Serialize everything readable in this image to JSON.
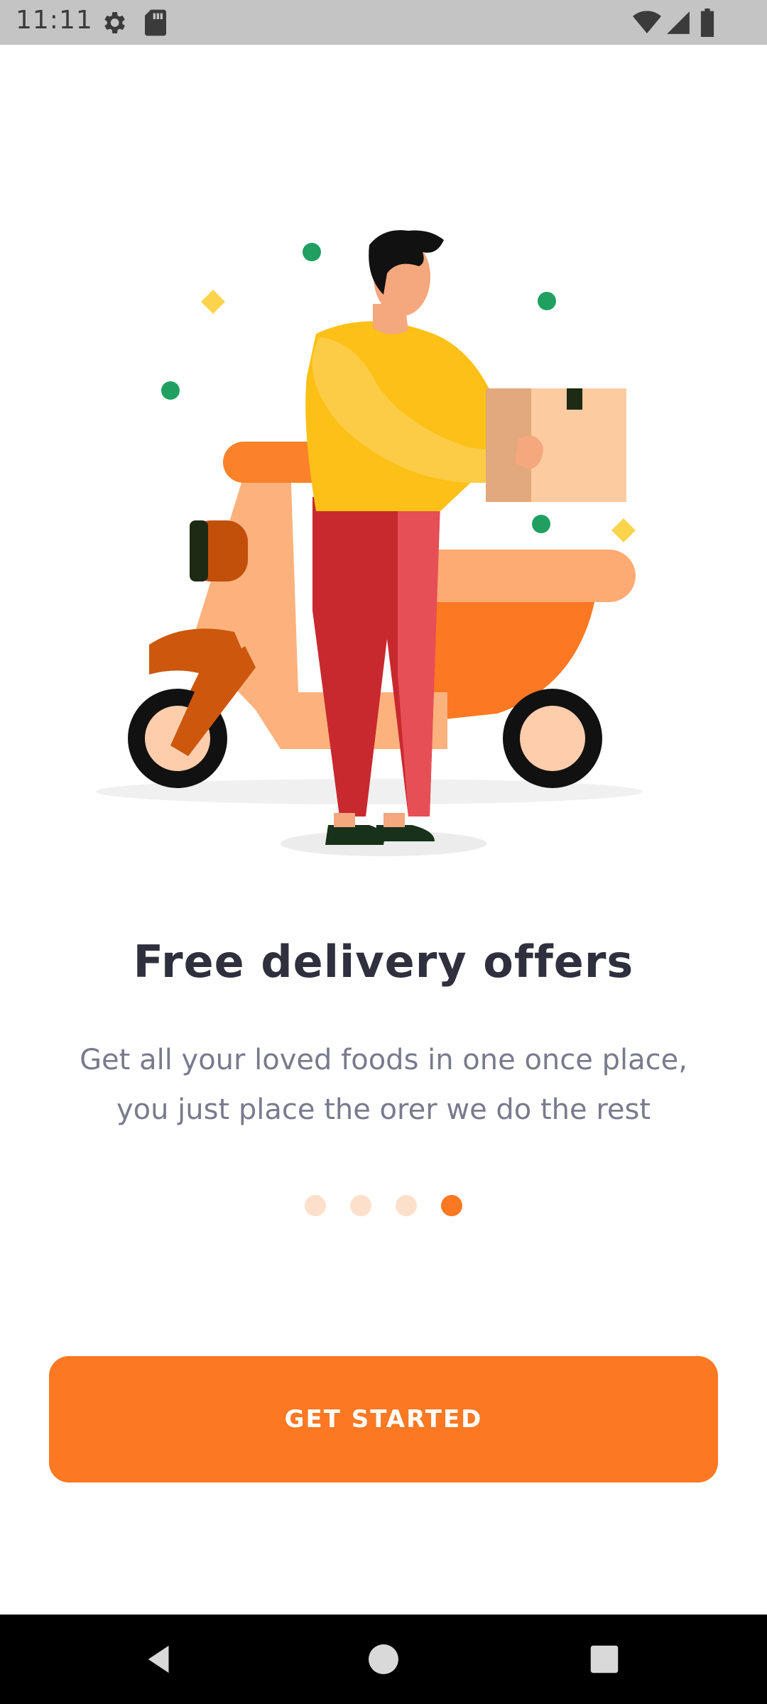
{
  "status_bar": {
    "time": "11:11",
    "icons": [
      "gear-icon",
      "sd-card-icon",
      "wifi-icon",
      "signal-icon",
      "battery-icon"
    ]
  },
  "onboarding": {
    "illustration": "delivery-man-with-scooter-and-box",
    "title": "Free delivery offers",
    "subtitle_line1": "Get all your loved foods in one once place,",
    "subtitle_line2": "you just place the orer we do the rest",
    "page_indicator": {
      "total": 4,
      "active": 4
    },
    "cta_label": "GET STARTED"
  },
  "nav_bar": {
    "buttons": [
      "back-icon",
      "home-icon",
      "recents-icon"
    ]
  },
  "colors": {
    "accent": "#fd7822",
    "indicator_inactive": "#fde0cc",
    "title": "#2f2f3e",
    "subtitle": "#7a7a8e"
  }
}
